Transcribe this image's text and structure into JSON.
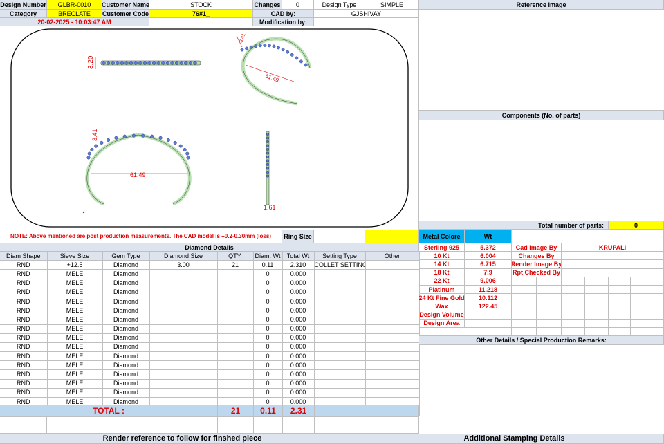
{
  "header": {
    "design_number_label": "Design Number",
    "design_number": "GLBR-0010",
    "customer_name_label": "Customer Name",
    "customer_name": "STOCK",
    "changes_label": "Changes",
    "changes": "0",
    "design_type_label": "Design Type",
    "design_type": "SIMPLE",
    "category_label": "Category",
    "category": "BRECLATE",
    "customer_code_label": "Customer Code",
    "customer_code": "76#1_",
    "cad_by_label": "CAD by:",
    "cad_by": "GJSHIVAY",
    "timestamp": "20-02-2025 - 10:03:47 AM",
    "modification_label": "Modification by:",
    "modification": ""
  },
  "drawing": {
    "dim_height_top": "3.20",
    "dim_top_right_small": "3.41",
    "dim_top_right_width": "61.49",
    "dim_front_height": "3.41",
    "dim_front_width": "61.49",
    "dim_side": "1.61"
  },
  "note": "NOTE: Above mentioned are post production measurements. The CAD model is +0.2-0.30mm (loss)",
  "ring_size_label": "Ring Size",
  "ring_size": "",
  "diamond": {
    "title": "Diamond Details",
    "columns": [
      "Diam Shape",
      "Sieve Size",
      "Gem Type",
      "Diamond Size",
      "QTY.",
      "Diam. Wt",
      "Total Wt",
      "Setting Type",
      "Other"
    ],
    "rows": [
      [
        "RND",
        "+12.5",
        "Diamond",
        "3.00",
        "21",
        "0.11",
        "2.310",
        "COLLET SETTING",
        ""
      ],
      [
        "RND",
        "MELE",
        "Diamond",
        "",
        "",
        "0",
        "0.000",
        "",
        ""
      ],
      [
        "RND",
        "MELE",
        "Diamond",
        "",
        "",
        "0",
        "0.000",
        "",
        ""
      ],
      [
        "RND",
        "MELE",
        "Diamond",
        "",
        "",
        "0",
        "0.000",
        "",
        ""
      ],
      [
        "RND",
        "MELE",
        "Diamond",
        "",
        "",
        "0",
        "0.000",
        "",
        ""
      ],
      [
        "RND",
        "MELE",
        "Diamond",
        "",
        "",
        "0",
        "0.000",
        "",
        ""
      ],
      [
        "RND",
        "MELE",
        "Diamond",
        "",
        "",
        "0",
        "0.000",
        "",
        ""
      ],
      [
        "RND",
        "MELE",
        "Diamond",
        "",
        "",
        "0",
        "0.000",
        "",
        ""
      ],
      [
        "RND",
        "MELE",
        "Diamond",
        "",
        "",
        "0",
        "0.000",
        "",
        ""
      ],
      [
        "RND",
        "MELE",
        "Diamond",
        "",
        "",
        "0",
        "0.000",
        "",
        ""
      ],
      [
        "RND",
        "MELE",
        "Diamond",
        "",
        "",
        "0",
        "0.000",
        "",
        ""
      ],
      [
        "RND",
        "MELE",
        "Diamond",
        "",
        "",
        "0",
        "0.000",
        "",
        ""
      ],
      [
        "RND",
        "MELE",
        "Diamond",
        "",
        "",
        "0",
        "0.000",
        "",
        ""
      ],
      [
        "RND",
        "MELE",
        "Diamond",
        "",
        "",
        "0",
        "0.000",
        "",
        ""
      ],
      [
        "RND",
        "MELE",
        "Diamond",
        "",
        "",
        "0",
        "0.000",
        "",
        ""
      ],
      [
        "RND",
        "MELE",
        "Diamond",
        "",
        "",
        "0",
        "0.000",
        "",
        ""
      ],
      [
        "RND",
        "MELE",
        "Diamond",
        "",
        "",
        "0",
        "0.000",
        "",
        ""
      ]
    ],
    "total_label": "TOTAL :",
    "total_qty": "21",
    "total_diam_wt": "0.11",
    "total_wt": "2.31"
  },
  "reference_image_title": "Reference Image",
  "components_title": "Components (No. of parts)",
  "total_parts_label": "Total number of parts:",
  "total_parts": "0",
  "metal": {
    "header_color": "Metal Colore",
    "header_wt": "Wt",
    "rows": [
      {
        "name": "Sterling 925",
        "wt": "5.372"
      },
      {
        "name": "10 Kt",
        "wt": "6.004"
      },
      {
        "name": "14 Kt",
        "wt": "6.715"
      },
      {
        "name": "18 Kt",
        "wt": "7.9"
      },
      {
        "name": "22 Kt",
        "wt": "9.006"
      },
      {
        "name": "Platinum",
        "wt": "11.218"
      },
      {
        "name": "24 Kt Fine Gold",
        "wt": "10.112"
      },
      {
        "name": "Wax",
        "wt": "122.45"
      },
      {
        "name": "Design Volume",
        "wt": ""
      },
      {
        "name": "Design Area",
        "wt": ""
      }
    ]
  },
  "staff": {
    "rows": [
      {
        "label": "Cad Image By",
        "value": "KRUPALI"
      },
      {
        "label": "Changes By",
        "value": ""
      },
      {
        "label": "Render Image By",
        "value": ""
      },
      {
        "label": "Rpt Checked By",
        "value": ""
      }
    ]
  },
  "other_details_title": "Other Details / Special Production Remarks:",
  "footer": {
    "render_reference": "Render reference to follow for finshed piece",
    "stamping": "Additional Stamping Details"
  },
  "colors": {
    "header_gray": "#dde4ee",
    "highlight_yellow": "#ffff00",
    "metal_blue": "#00b0f0",
    "red_text": "#e00000",
    "total_blue": "#bdd7ee"
  }
}
